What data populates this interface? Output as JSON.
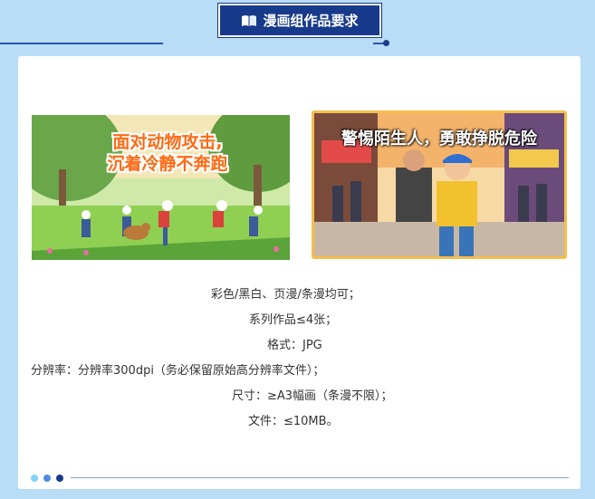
{
  "header": {
    "title": "漫画组作品要求",
    "icon": "book-icon",
    "badge_color": "#173a8a"
  },
  "images": [
    {
      "caption_line1": "面对动物攻击,",
      "caption_line2": "沉着冷静不奔跑"
    },
    {
      "caption": "警惕陌生人，勇敢挣脱危险"
    }
  ],
  "requirements": [
    "彩色/黑白、页漫/条漫均可；",
    "系列作品≤4张；",
    "格式：JPG",
    "分辨率：分辨率300dpi（务必保留原始高分辨率文件）；",
    "尺寸：≥A3幅画（条漫不限）；",
    "文件：≤10MB。"
  ],
  "colors": {
    "page_bg": "#b9dcf7",
    "accent_border": "#f5bd4b",
    "caption_orange": "#ff6a13",
    "dots": [
      "#7fd3f7",
      "#4f8be0",
      "#173a8a"
    ]
  }
}
